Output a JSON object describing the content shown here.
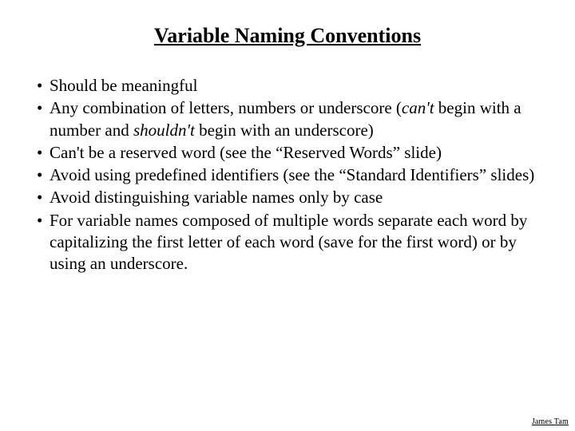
{
  "title": "Variable Naming Conventions",
  "bullets": {
    "b0": "Should be meaningful",
    "b1a": "Any combination of letters, numbers or underscore (",
    "b1_i1": "can't",
    "b1b": " begin with a number and ",
    "b1_i2": "shouldn't",
    "b1c": " begin with an underscore)",
    "b2": "Can't be a reserved word (see the “Reserved Words” slide)",
    "b3": "Avoid using predefined identifiers (see the “Standard Identifiers” slides)",
    "b4": "Avoid distinguishing variable names only by case",
    "b5": "For variable names composed of multiple words separate each word by capitalizing the first letter of each word (save for the first word) or by using an underscore."
  },
  "marker": "•",
  "footer": "James Tam"
}
